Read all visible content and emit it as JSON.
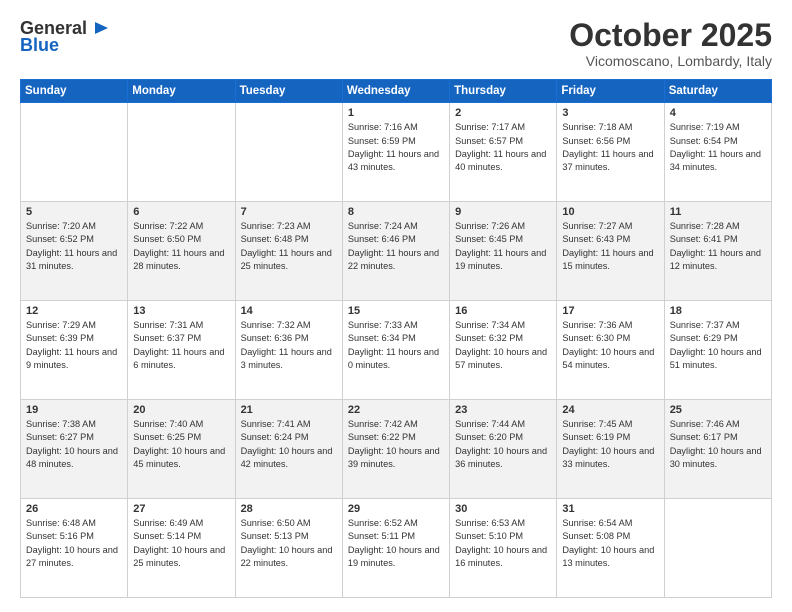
{
  "logo": {
    "general": "General",
    "blue": "Blue"
  },
  "title": "October 2025",
  "location": "Vicomoscano, Lombardy, Italy",
  "days_header": [
    "Sunday",
    "Monday",
    "Tuesday",
    "Wednesday",
    "Thursday",
    "Friday",
    "Saturday"
  ],
  "weeks": [
    [
      {
        "day": "",
        "info": ""
      },
      {
        "day": "",
        "info": ""
      },
      {
        "day": "",
        "info": ""
      },
      {
        "day": "1",
        "info": "Sunrise: 7:16 AM\nSunset: 6:59 PM\nDaylight: 11 hours and 43 minutes."
      },
      {
        "day": "2",
        "info": "Sunrise: 7:17 AM\nSunset: 6:57 PM\nDaylight: 11 hours and 40 minutes."
      },
      {
        "day": "3",
        "info": "Sunrise: 7:18 AM\nSunset: 6:56 PM\nDaylight: 11 hours and 37 minutes."
      },
      {
        "day": "4",
        "info": "Sunrise: 7:19 AM\nSunset: 6:54 PM\nDaylight: 11 hours and 34 minutes."
      }
    ],
    [
      {
        "day": "5",
        "info": "Sunrise: 7:20 AM\nSunset: 6:52 PM\nDaylight: 11 hours and 31 minutes."
      },
      {
        "day": "6",
        "info": "Sunrise: 7:22 AM\nSunset: 6:50 PM\nDaylight: 11 hours and 28 minutes."
      },
      {
        "day": "7",
        "info": "Sunrise: 7:23 AM\nSunset: 6:48 PM\nDaylight: 11 hours and 25 minutes."
      },
      {
        "day": "8",
        "info": "Sunrise: 7:24 AM\nSunset: 6:46 PM\nDaylight: 11 hours and 22 minutes."
      },
      {
        "day": "9",
        "info": "Sunrise: 7:26 AM\nSunset: 6:45 PM\nDaylight: 11 hours and 19 minutes."
      },
      {
        "day": "10",
        "info": "Sunrise: 7:27 AM\nSunset: 6:43 PM\nDaylight: 11 hours and 15 minutes."
      },
      {
        "day": "11",
        "info": "Sunrise: 7:28 AM\nSunset: 6:41 PM\nDaylight: 11 hours and 12 minutes."
      }
    ],
    [
      {
        "day": "12",
        "info": "Sunrise: 7:29 AM\nSunset: 6:39 PM\nDaylight: 11 hours and 9 minutes."
      },
      {
        "day": "13",
        "info": "Sunrise: 7:31 AM\nSunset: 6:37 PM\nDaylight: 11 hours and 6 minutes."
      },
      {
        "day": "14",
        "info": "Sunrise: 7:32 AM\nSunset: 6:36 PM\nDaylight: 11 hours and 3 minutes."
      },
      {
        "day": "15",
        "info": "Sunrise: 7:33 AM\nSunset: 6:34 PM\nDaylight: 11 hours and 0 minutes."
      },
      {
        "day": "16",
        "info": "Sunrise: 7:34 AM\nSunset: 6:32 PM\nDaylight: 10 hours and 57 minutes."
      },
      {
        "day": "17",
        "info": "Sunrise: 7:36 AM\nSunset: 6:30 PM\nDaylight: 10 hours and 54 minutes."
      },
      {
        "day": "18",
        "info": "Sunrise: 7:37 AM\nSunset: 6:29 PM\nDaylight: 10 hours and 51 minutes."
      }
    ],
    [
      {
        "day": "19",
        "info": "Sunrise: 7:38 AM\nSunset: 6:27 PM\nDaylight: 10 hours and 48 minutes."
      },
      {
        "day": "20",
        "info": "Sunrise: 7:40 AM\nSunset: 6:25 PM\nDaylight: 10 hours and 45 minutes."
      },
      {
        "day": "21",
        "info": "Sunrise: 7:41 AM\nSunset: 6:24 PM\nDaylight: 10 hours and 42 minutes."
      },
      {
        "day": "22",
        "info": "Sunrise: 7:42 AM\nSunset: 6:22 PM\nDaylight: 10 hours and 39 minutes."
      },
      {
        "day": "23",
        "info": "Sunrise: 7:44 AM\nSunset: 6:20 PM\nDaylight: 10 hours and 36 minutes."
      },
      {
        "day": "24",
        "info": "Sunrise: 7:45 AM\nSunset: 6:19 PM\nDaylight: 10 hours and 33 minutes."
      },
      {
        "day": "25",
        "info": "Sunrise: 7:46 AM\nSunset: 6:17 PM\nDaylight: 10 hours and 30 minutes."
      }
    ],
    [
      {
        "day": "26",
        "info": "Sunrise: 6:48 AM\nSunset: 5:16 PM\nDaylight: 10 hours and 27 minutes."
      },
      {
        "day": "27",
        "info": "Sunrise: 6:49 AM\nSunset: 5:14 PM\nDaylight: 10 hours and 25 minutes."
      },
      {
        "day": "28",
        "info": "Sunrise: 6:50 AM\nSunset: 5:13 PM\nDaylight: 10 hours and 22 minutes."
      },
      {
        "day": "29",
        "info": "Sunrise: 6:52 AM\nSunset: 5:11 PM\nDaylight: 10 hours and 19 minutes."
      },
      {
        "day": "30",
        "info": "Sunrise: 6:53 AM\nSunset: 5:10 PM\nDaylight: 10 hours and 16 minutes."
      },
      {
        "day": "31",
        "info": "Sunrise: 6:54 AM\nSunset: 5:08 PM\nDaylight: 10 hours and 13 minutes."
      },
      {
        "day": "",
        "info": ""
      }
    ]
  ]
}
